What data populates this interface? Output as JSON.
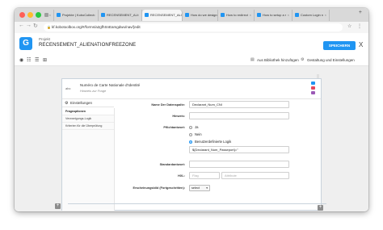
{
  "browser": {
    "tabs": [
      {
        "label": "",
        "favicon_color": "#9e9e9e",
        "active": false
      },
      {
        "label": "Projekte | KoboCollect",
        "favicon_color": "#2095f2",
        "active": false
      },
      {
        "label": "RECENSEMENT_ALI",
        "favicon_color": "#2095f2",
        "active": false
      },
      {
        "label": "RECENSEMENT_ALI",
        "favicon_color": "#2095f2",
        "active": true
      },
      {
        "label": "How do we design",
        "favicon_color": "#2095f2",
        "active": false
      },
      {
        "label": "How to redirect",
        "favicon_color": "#2095f2",
        "active": false
      },
      {
        "label": "How to setup a r",
        "favicon_color": "#2095f2",
        "active": false
      },
      {
        "label": "Custom Login n",
        "favicon_color": "#2095f2",
        "active": false
      }
    ],
    "url": "kf.kobotoolbox.org/#/forms/a2gfhSnEamgdwu/nav/{edit"
  },
  "header": {
    "logo": "G",
    "project_label": "Projekt",
    "project_name": "RECENSEMENT_ALIENATIONFREEZONE",
    "save_label": "SPEICHERN",
    "close_label": "X"
  },
  "form_toolbar": {
    "library_label": "Aus Bibliothek hinzufügen",
    "settings_label": "Gestaltung und Einstellungen"
  },
  "question": {
    "type_abbr": "abc",
    "label": "Numéro de Carte Nationale d'Identité",
    "hint": "Hinweis zur Frage",
    "settings_title": "Einstellungen",
    "side_items": [
      "Frageoptionen",
      "Verzweigungs-Logik",
      "Kriterien für die Überprüfung"
    ],
    "fields": {
      "data_column_label": "Name Der Datenspalte:",
      "data_column_value": "Declarant_Num_CNI",
      "hint_label": "Hinweis:",
      "hint_value": "",
      "required_label": "Pflichtantwort:",
      "required_options": [
        "Ja",
        "Nein",
        "Benutzerdefinierte Logik"
      ],
      "required_selected": 2,
      "custom_logic_value": "${Declarant_Num_Passeport}=''",
      "default_label": "Standardantwort:",
      "default_value": "",
      "hxl_label": "HXL:",
      "hxl_tag_placeholder": "Flag",
      "hxl_attr_placeholder": "Attribute",
      "appearance_label": "Erscheinungsbild (Fortgeschritten):",
      "appearance_value": "select"
    }
  },
  "colors": {
    "accent": "#2095f2",
    "chip_top": "#2095f2",
    "chip_mid": "#e5485c",
    "chip_bot": "#9b59b6"
  }
}
